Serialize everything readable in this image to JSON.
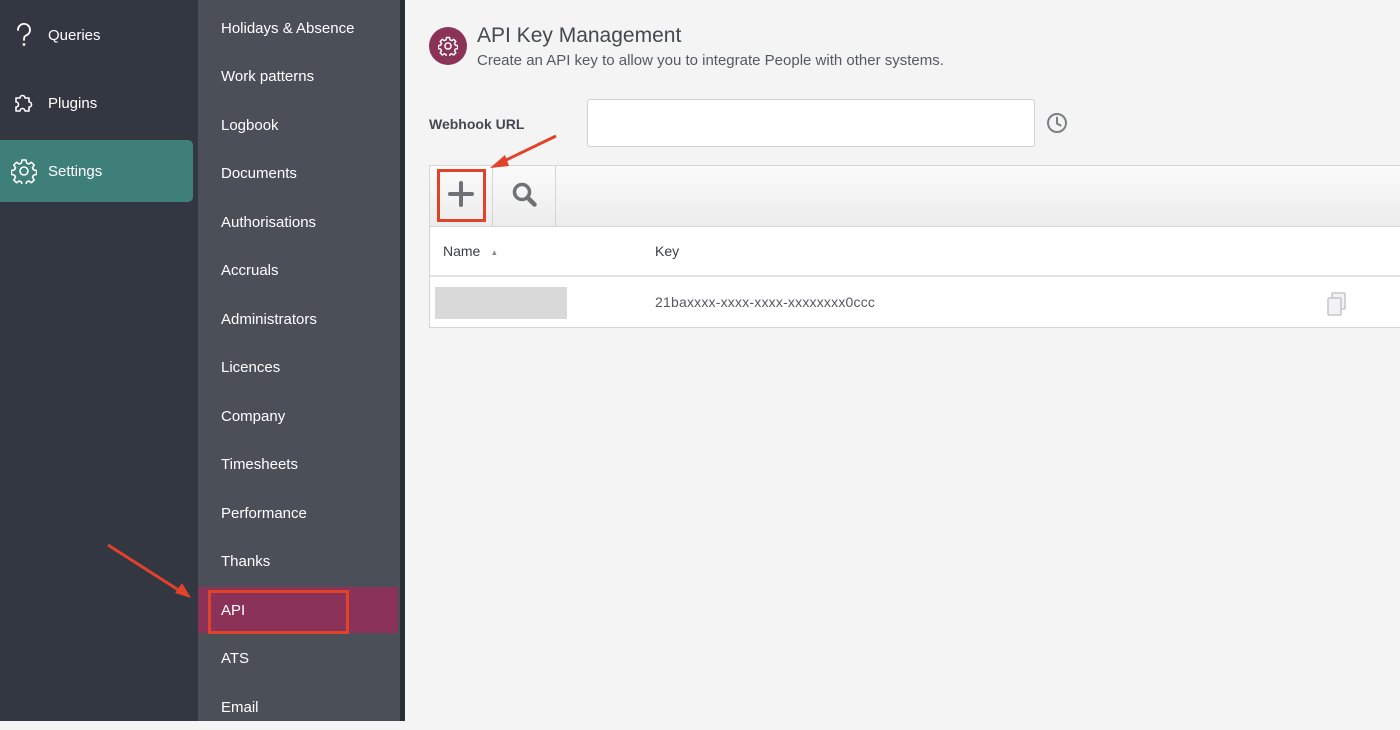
{
  "nav_primary": [
    {
      "label": "Queries",
      "icon": "question-icon"
    },
    {
      "label": "Plugins",
      "icon": "puzzle-icon"
    },
    {
      "label": "Settings",
      "icon": "gear-icon",
      "active": true
    }
  ],
  "nav_secondary": [
    {
      "label": "Holidays & Absence"
    },
    {
      "label": "Work patterns"
    },
    {
      "label": "Logbook"
    },
    {
      "label": "Documents"
    },
    {
      "label": "Authorisations"
    },
    {
      "label": "Accruals"
    },
    {
      "label": "Administrators"
    },
    {
      "label": "Licences"
    },
    {
      "label": "Company"
    },
    {
      "label": "Timesheets"
    },
    {
      "label": "Performance"
    },
    {
      "label": "Thanks"
    },
    {
      "label": "API",
      "active": true
    },
    {
      "label": "ATS"
    },
    {
      "label": "Email"
    }
  ],
  "page": {
    "title": "API Key Management",
    "subtitle": "Create an API key to allow you to integrate People with other systems.",
    "icon": "gear-icon"
  },
  "webhook": {
    "label": "Webhook URL",
    "value": "",
    "placeholder": "",
    "history_icon": "clock-icon"
  },
  "toolbar": {
    "add_icon": "plus-icon",
    "search_icon": "search-icon"
  },
  "table": {
    "columns": [
      "Name",
      "Key"
    ],
    "rows": [
      {
        "name": "",
        "key": "21baxxxx-xxxx-xxxx-xxxxxxxx0ccc",
        "copy_icon": "copy-icon"
      }
    ]
  },
  "colors": {
    "nav_primary_bg": "#323741",
    "nav_secondary_bg": "#4a4f58",
    "settings_active": "#3f7f7a",
    "api_active": "#8b3258",
    "annotation": "#e0432a"
  }
}
